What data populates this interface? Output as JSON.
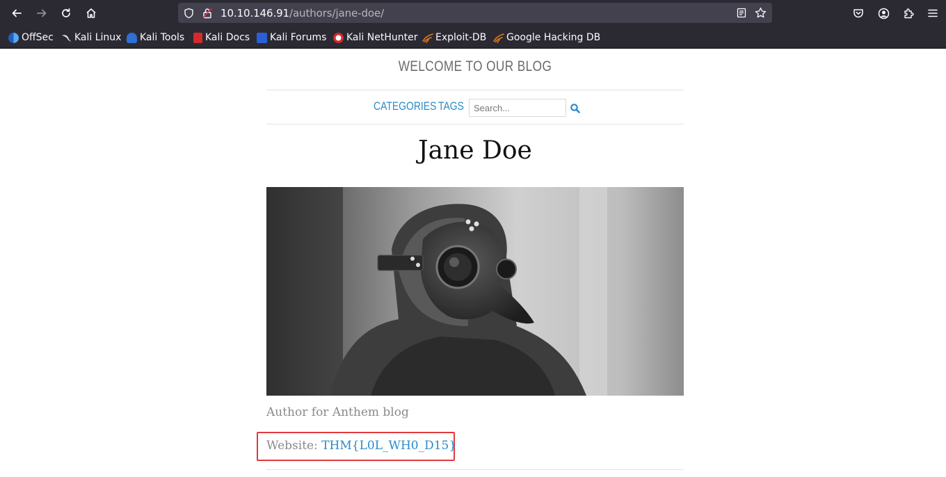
{
  "browser": {
    "url_host": "10.10.146.91",
    "url_path": "/authors/jane-doe/",
    "bookmarks": [
      {
        "label": "OffSec",
        "icon": "offsec-icon",
        "color": "#3a8ee6"
      },
      {
        "label": "Kali Linux",
        "icon": "kali-dragon-icon",
        "color": "#1a1a1a"
      },
      {
        "label": "Kali Tools",
        "icon": "kali-tools-icon",
        "color": "#2f6fd6"
      },
      {
        "label": "Kali Docs",
        "icon": "kali-docs-icon",
        "color": "#d42a2a"
      },
      {
        "label": "Kali Forums",
        "icon": "kali-forums-icon",
        "color": "#2a5fd6"
      },
      {
        "label": "Kali NetHunter",
        "icon": "nethunter-icon",
        "color": "#d42a2a"
      },
      {
        "label": "Exploit-DB",
        "icon": "exploit-db-icon",
        "color": "#e07b1a"
      },
      {
        "label": "Google Hacking DB",
        "icon": "ghdb-icon",
        "color": "#e07b1a"
      }
    ]
  },
  "blog": {
    "title": "WELCOME TO OUR BLOG",
    "nav": {
      "categories": "CATEGORIES",
      "tags": "TAGS",
      "search_placeholder": "Search..."
    }
  },
  "author": {
    "name": "Jane Doe",
    "photo": "plague-doctor-mask-photo",
    "bio": "Author for Anthem blog",
    "website_label": "Website:",
    "website_value": "THM{L0L_WH0_D15}"
  },
  "colors": {
    "link": "#2a8bc6",
    "highlight": "#e0393e",
    "chrome_bg": "#2b2a33"
  }
}
